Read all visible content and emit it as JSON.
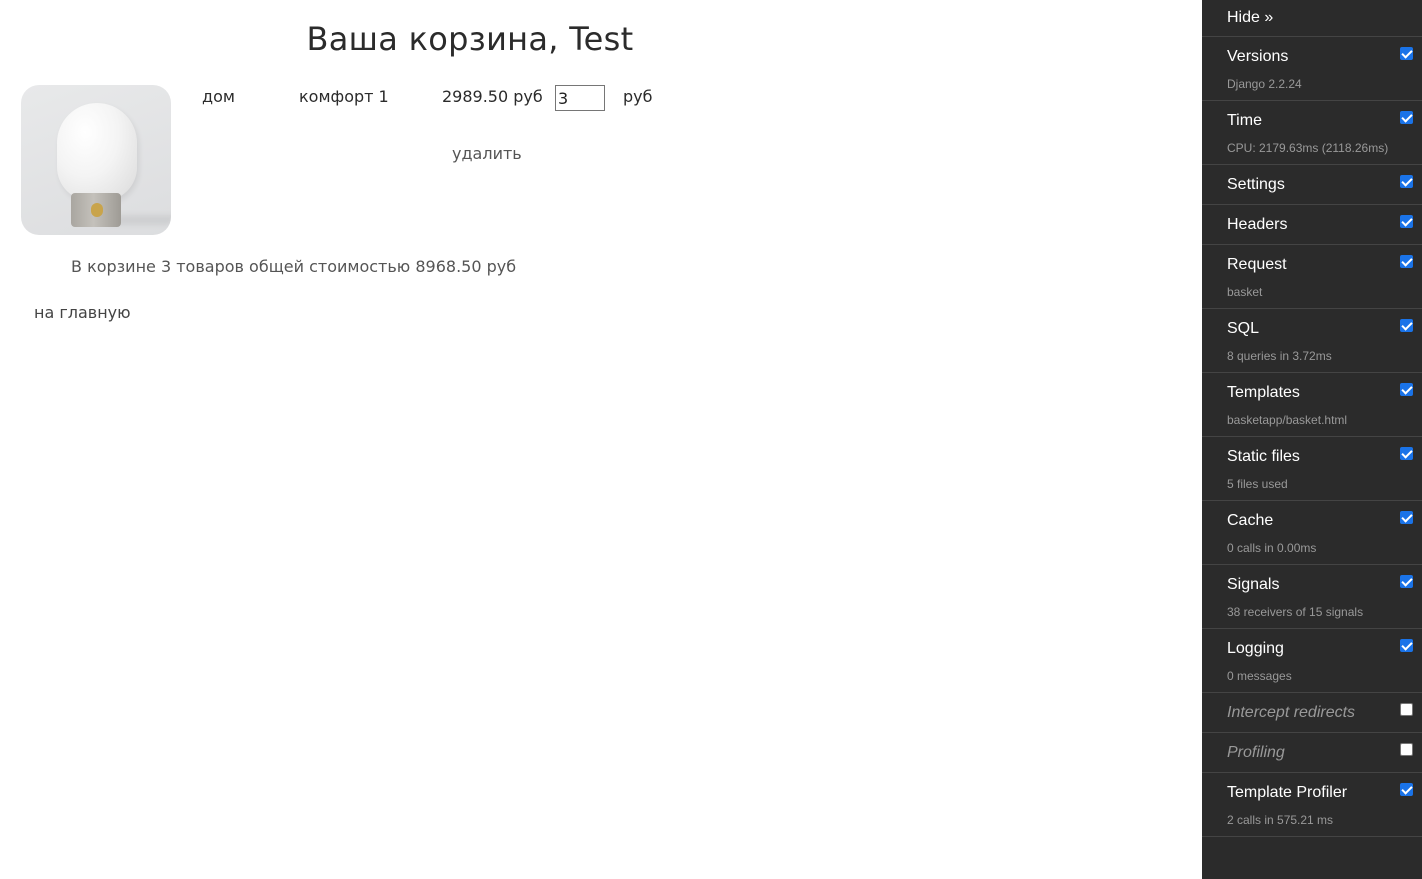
{
  "page": {
    "title": "Ваша корзина, Test"
  },
  "basket_item": {
    "image_alt": "lamp-product-image",
    "category": "дом",
    "name": "комфорт 1",
    "price": "2989.50 руб",
    "quantity": "3",
    "currency": "руб",
    "delete_label": "удалить"
  },
  "summary": "В корзине 3 товаров общей стоимостью 8968.50 руб",
  "home_link": "на главную",
  "debug_toolbar": {
    "hide_label": "Hide »",
    "panels": [
      {
        "title": "Versions",
        "subtitle": "Django 2.2.24",
        "checked": true
      },
      {
        "title": "Time",
        "subtitle": "CPU: 2179.63ms (2118.26ms)",
        "checked": true
      },
      {
        "title": "Settings",
        "subtitle": "",
        "checked": true
      },
      {
        "title": "Headers",
        "subtitle": "",
        "checked": true
      },
      {
        "title": "Request",
        "subtitle": "basket",
        "checked": true
      },
      {
        "title": "SQL",
        "subtitle": "8 queries in 3.72ms",
        "checked": true
      },
      {
        "title": "Templates",
        "subtitle": "basketapp/basket.html",
        "checked": true
      },
      {
        "title": "Static files",
        "subtitle": "5 files used",
        "checked": true
      },
      {
        "title": "Cache",
        "subtitle": "0 calls in 0.00ms",
        "checked": true
      },
      {
        "title": "Signals",
        "subtitle": "38 receivers of 15 signals",
        "checked": true
      },
      {
        "title": "Logging",
        "subtitle": "0 messages",
        "checked": true
      },
      {
        "title": "Intercept redirects",
        "subtitle": "",
        "checked": false
      },
      {
        "title": "Profiling",
        "subtitle": "",
        "checked": false
      },
      {
        "title": "Template Profiler",
        "subtitle": "2 calls in 575.21 ms",
        "checked": true
      }
    ]
  },
  "colors": {
    "toolbar_bg": "#2b2b2b",
    "checkbox_accent": "#1a73e8"
  }
}
